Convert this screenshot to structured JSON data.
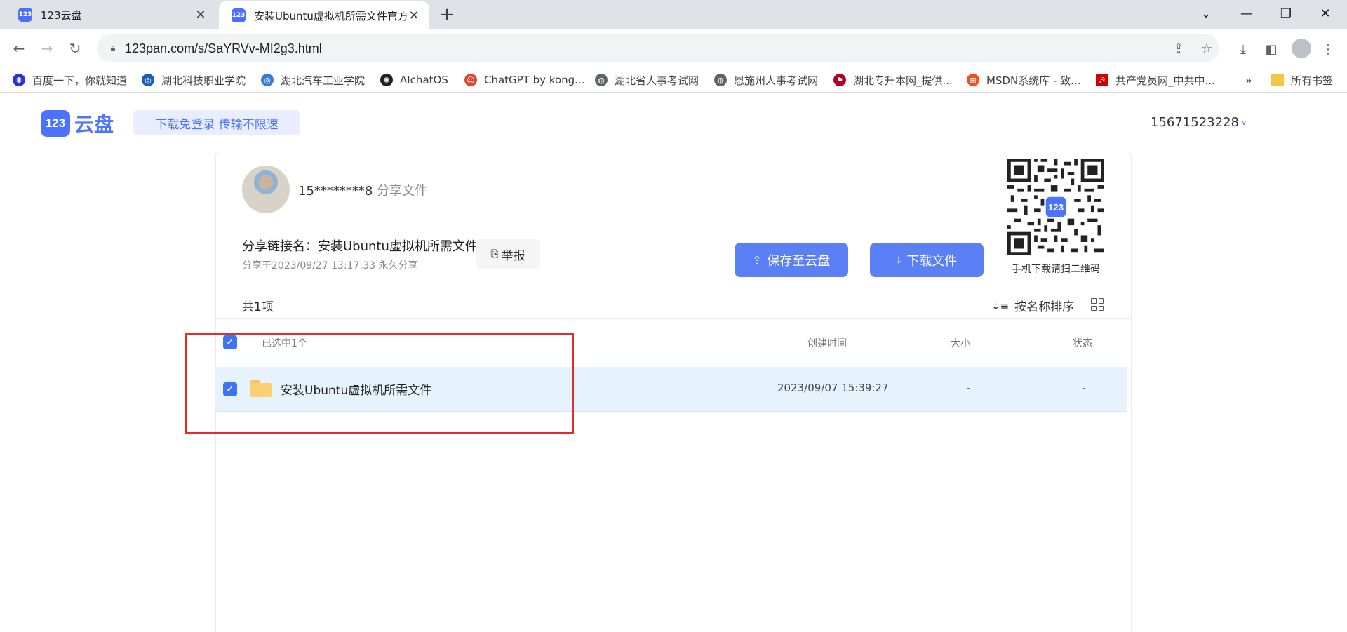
{
  "browser": {
    "tabs": [
      {
        "title": "123云盘",
        "favicon": "123",
        "active": false
      },
      {
        "title": "安装Ubuntu虚拟机所需文件官方",
        "favicon": "123",
        "active": true
      }
    ],
    "url": "123pan.com/s/SaYRVv-MI2g3.html",
    "bookmarks": [
      {
        "label": "百度一下，你就知道",
        "icon": "paw-icon",
        "color": "#2932e1"
      },
      {
        "label": "湖北科技职业学院",
        "icon": "school-icon",
        "color": "#1a5fb4"
      },
      {
        "label": "湖北汽车工业学院",
        "icon": "school-icon",
        "color": "#3a7bd5"
      },
      {
        "label": "AIchatOS",
        "icon": "openai-icon",
        "color": "#222222"
      },
      {
        "label": "ChatGPT by kong...",
        "icon": "character-icon",
        "color": "#e0452f"
      },
      {
        "label": "湖北省人事考试网",
        "icon": "globe-icon",
        "color": "#5f6368"
      },
      {
        "label": "恩施州人事考试网",
        "icon": "globe-icon",
        "color": "#5f6368"
      },
      {
        "label": "湖北专升本网_提供...",
        "icon": "flag-icon",
        "color": "#b00020"
      },
      {
        "label": "MSDN系统库 - 致...",
        "icon": "windows-icon",
        "color": "#f25022"
      },
      {
        "label": "共产党员网_中共中...",
        "icon": "party-icon",
        "color": "#d40000"
      }
    ],
    "bookmarks_overflow": "»",
    "all_bookmarks": "所有书签"
  },
  "header": {
    "logo_mark": "123",
    "logo_text": "云盘",
    "promo": "下载免登录  传输不限速",
    "user_id": "15671523228",
    "user_caret": "v"
  },
  "share": {
    "sharer_masked": "15********8",
    "sharer_suffix": "分享文件",
    "link_name": "分享链接名：安装Ubuntu虚拟机所需文件",
    "meta": "分享于2023/09/27 13:17:33 永久分享",
    "report": "举报",
    "save_button": "保存至云盘",
    "download_button": "下载文件",
    "qr_caption": "手机下载请扫二维码",
    "qr_badge": "123"
  },
  "list": {
    "count": "共1项",
    "sort": "按名称排序",
    "headers": {
      "selected": "已选中1个",
      "created": "创建时间",
      "size": "大小",
      "status": "状态"
    },
    "rows": [
      {
        "name": "安装Ubuntu虚拟机所需文件",
        "created": "2023/09/07 15:39:27",
        "size": "-",
        "status": "-"
      }
    ]
  },
  "colors": {
    "accent": "#5b7ff5",
    "brand": "#4c73ff",
    "highlight": "#e52c2c",
    "selected_row": "#e6f3fc"
  }
}
